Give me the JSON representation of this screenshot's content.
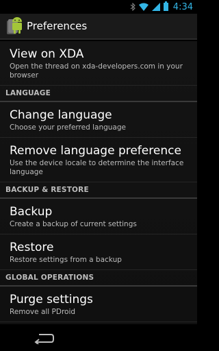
{
  "status_bar": {
    "time": "4:34",
    "icons": [
      "bluetooth-icon",
      "wifi-icon",
      "signal-icon",
      "battery-icon"
    ],
    "accent_color": "#33b5e5"
  },
  "action_bar": {
    "title": "Preferences",
    "app_icon": "android-app-icon"
  },
  "preferences": {
    "view_on_xda": {
      "title": "View on XDA",
      "summary": "Open the thread on xda-developers.com in your browser"
    },
    "language_category": "LANGUAGE",
    "change_language": {
      "title": "Change language",
      "summary": "Choose your preferred language"
    },
    "remove_language": {
      "title": "Remove language preference",
      "summary": "Use the device locale to determine the interface language"
    },
    "backup_category": "BACKUP & RESTORE",
    "backup": {
      "title": "Backup",
      "summary": "Create a backup of current settings"
    },
    "restore": {
      "title": "Restore",
      "summary": "Restore settings from a backup"
    },
    "global_category": "GLOBAL OPERATIONS",
    "purge": {
      "title": "Purge settings",
      "summary": "Remove all PDroid"
    }
  },
  "nav_bar": {
    "back_icon": "back-icon"
  }
}
